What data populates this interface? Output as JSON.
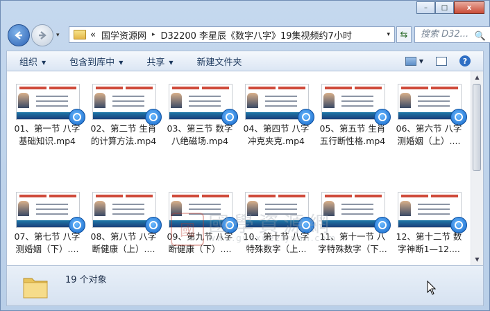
{
  "window": {
    "caption_buttons": {
      "minimize": "–",
      "maximize": "□",
      "close": "x"
    }
  },
  "nav": {
    "back_icon": "back-arrow-icon",
    "forward_icon": "forward-arrow-icon",
    "recent_dropdown": "▾",
    "address_parts": [
      "«",
      "国学资源网",
      "▸",
      "D32200 李星辰《数字八字》19集视频约7小时"
    ],
    "search_placeholder": "搜索 D32...",
    "search_icon": "🔍"
  },
  "toolbar": {
    "organize": "组织",
    "include_library": "包含到库中",
    "share": "共享",
    "new_folder": "新建文件夹",
    "dropdown_arrow": "▼",
    "help": "?"
  },
  "files": [
    {
      "line1": "01、第一节 八字",
      "line2": "基础知识.mp4"
    },
    {
      "line1": "02、第二节 生肖",
      "line2": "的计算方法.mp4"
    },
    {
      "line1": "03、第三节 数字",
      "line2": "八绝磁场.mp4"
    },
    {
      "line1": "04、第四节 八字",
      "line2": "冲克夹克.mp4"
    },
    {
      "line1": "05、第五节 生肖",
      "line2": "五行断性格.mp4"
    },
    {
      "line1": "06、第六节 八字",
      "line2": "测婚姻（上）...."
    },
    {
      "line1": "07、第七节 八字",
      "line2": "测婚姻（下）...."
    },
    {
      "line1": "08、第八节 八字",
      "line2": "断健康（上）...."
    },
    {
      "line1": "09、第九节 八字",
      "line2": "断健康（下）...."
    },
    {
      "line1": "10、第十节 八字",
      "line2": "特殊数字（上..."
    },
    {
      "line1": "11、第十一节 八",
      "line2": "字特殊数字（下..."
    },
    {
      "line1": "12、第十二节 数",
      "line2": "字神断1—12...."
    }
  ],
  "watermark": {
    "seal": "國",
    "title": "國學資源網",
    "url": "www.guoxueziyuan.com"
  },
  "status": {
    "count": "19 个对象"
  },
  "scroll": {
    "up": "▲",
    "down": "▼"
  }
}
